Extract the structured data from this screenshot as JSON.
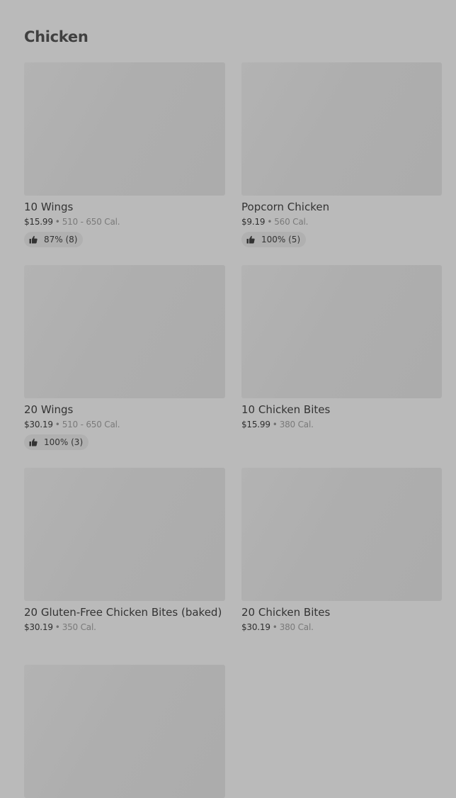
{
  "section": {
    "title": "Chicken"
  },
  "items": [
    {
      "name": "10 Wings",
      "price": "$15.99",
      "calories": "510 - 650 Cal.",
      "rating": "87% (8)"
    },
    {
      "name": "Popcorn Chicken",
      "price": "$9.19",
      "calories": "560 Cal.",
      "rating": "100% (5)"
    },
    {
      "name": "20 Wings",
      "price": "$30.19",
      "calories": "510 - 650 Cal.",
      "rating": "100% (3)"
    },
    {
      "name": "10 Chicken Bites",
      "price": "$15.99",
      "calories": "380 Cal."
    },
    {
      "name": "20 Gluten-Free Chicken Bites (baked)",
      "price": "$30.19",
      "calories": "350 Cal."
    },
    {
      "name": "20 Chicken Bites",
      "price": "$30.19",
      "calories": "380 Cal."
    }
  ],
  "meta_separator": "•",
  "icons": {
    "rating": "thumbs-up-icon"
  }
}
